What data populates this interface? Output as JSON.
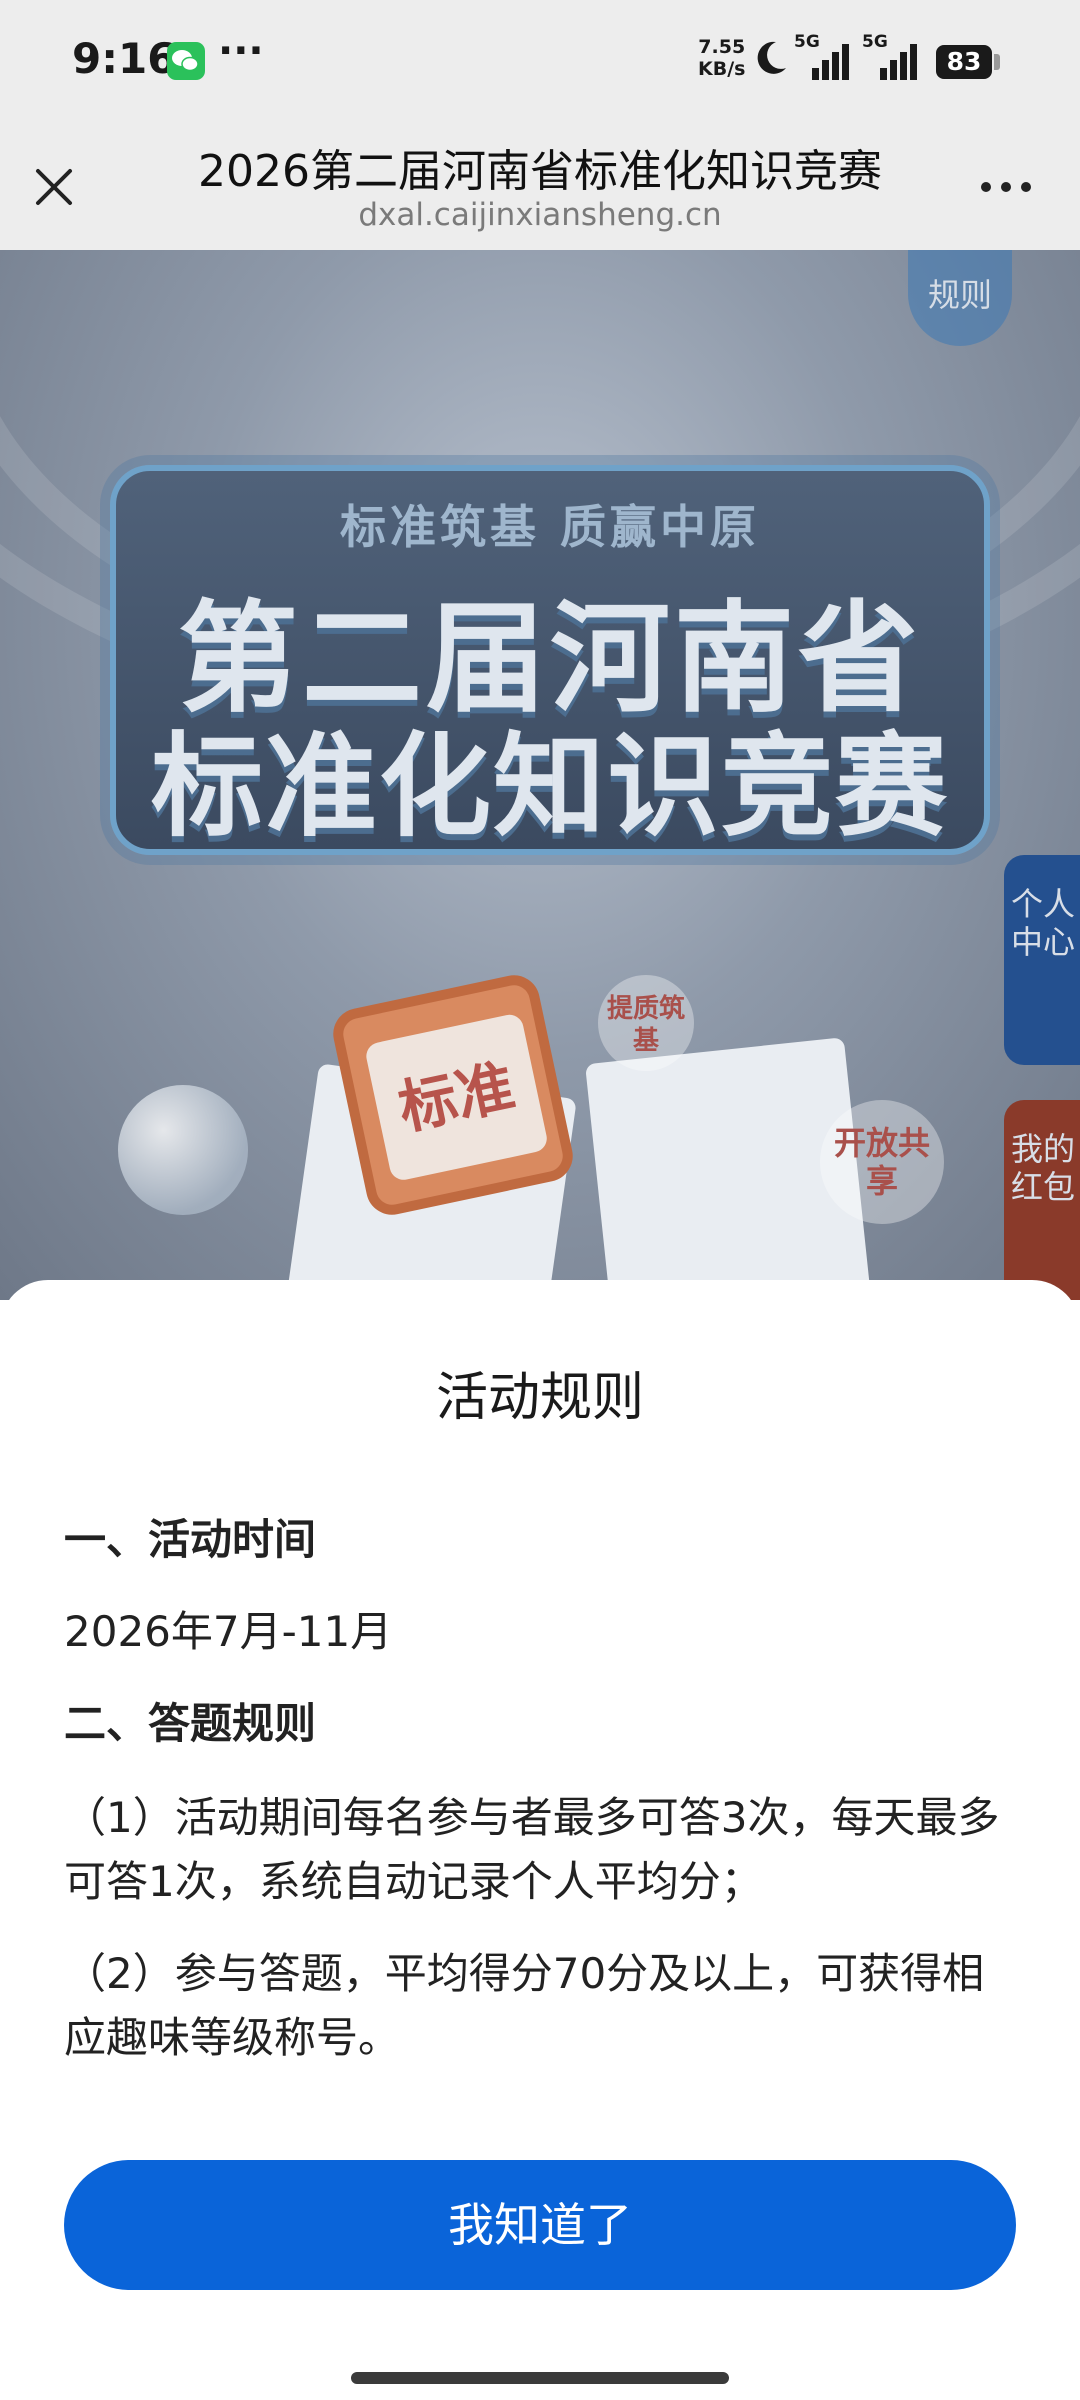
{
  "status_bar": {
    "time": "9:16",
    "menu_dots": "···",
    "net_speed_value": "7.55",
    "net_speed_unit": "KB/s",
    "sim1_label": "5G",
    "sim2_label": "5G",
    "battery": "83"
  },
  "browser": {
    "title": "2026第二届河南省标准化知识竞赛",
    "domain": "dxal.caijinxiansheng.cn"
  },
  "page": {
    "rules_link": "规则",
    "banner_slogan": "标准筑基  质赢中原",
    "banner_line1": "第二届河南省",
    "banner_line2": "标准化知识竞赛",
    "side_tab_personal": "个人中心",
    "side_tab_redpacket": "我的红包",
    "badge_quality": "提质筑基",
    "badge_open": "开放共享",
    "calendar_text": "标准"
  },
  "sheet": {
    "title": "活动规则",
    "section1_heading": "一、活动时间",
    "section1_text": "2026年7月-11月",
    "section2_heading": "二、答题规则",
    "rule1": "（1）活动期间每名参与者最多可答3次，每天最多可答1次，系统自动记录个人平均分；",
    "rule2": "（2）参与答题，平均得分70分及以上，可获得相应趣味等级称号。",
    "confirm_button": "我知道了"
  },
  "colors": {
    "accent_button": "#0a64d9",
    "wechat_green": "#2bc15b"
  }
}
